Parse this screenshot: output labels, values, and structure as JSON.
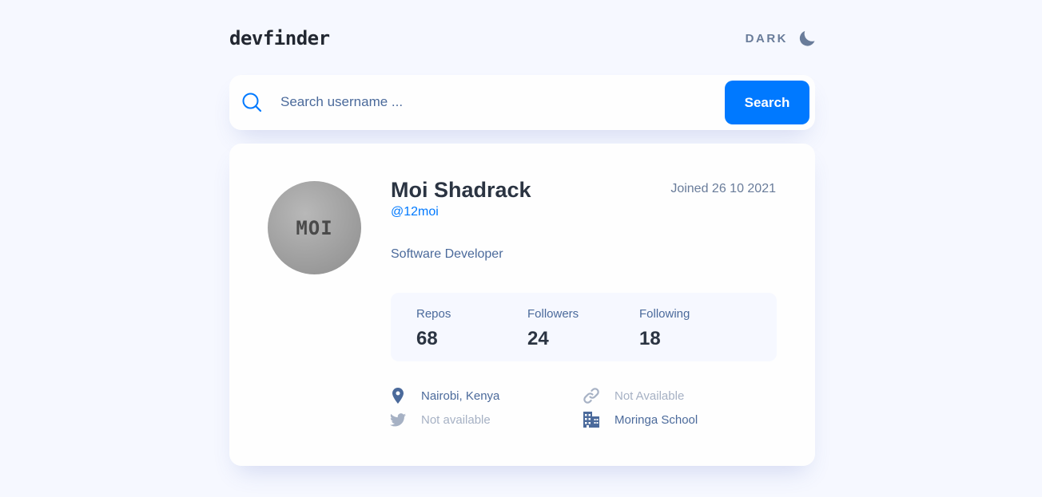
{
  "header": {
    "logo": "devfinder",
    "theme_label": "DARK",
    "theme_icon": "moon-icon"
  },
  "search": {
    "placeholder": "Search username ...",
    "value": "",
    "button_label": "Search",
    "icon": "search-icon"
  },
  "profile": {
    "avatar_text": "MOI",
    "name": "Moi Shadrack",
    "login": "@12moi",
    "joined": "Joined 26 10 2021",
    "bio": "Software Developer"
  },
  "stats": [
    {
      "label": "Repos",
      "value": "68"
    },
    {
      "label": "Followers",
      "value": "24"
    },
    {
      "label": "Following",
      "value": "18"
    }
  ],
  "links": {
    "location": {
      "text": "Nairobi, Kenya",
      "icon": "location-pin-icon",
      "available": true
    },
    "website": {
      "text": "Not Available",
      "icon": "link-icon",
      "available": false
    },
    "twitter": {
      "text": "Not available",
      "icon": "twitter-icon",
      "available": false
    },
    "company": {
      "text": "Moringa School",
      "icon": "building-icon",
      "available": true
    }
  },
  "colors": {
    "accent": "#0079ff",
    "background": "#f6f8ff",
    "card": "#fefefe",
    "heading": "#2b3442",
    "text": "#4b6a9b",
    "muted": "#a6b1c4"
  }
}
